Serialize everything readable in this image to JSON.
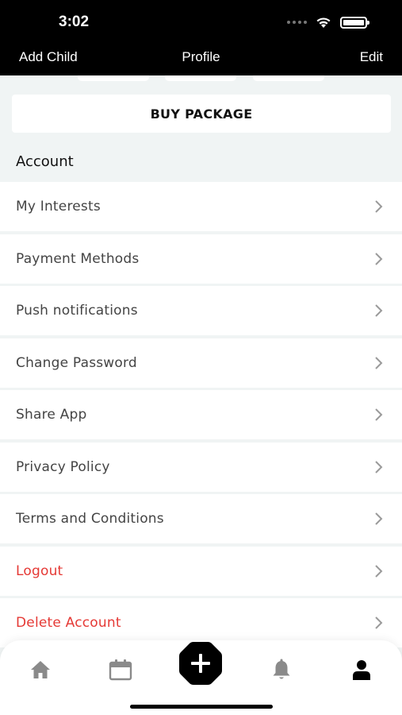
{
  "status_bar": {
    "time": "3:02"
  },
  "nav": {
    "left": "Add Child",
    "title": "Profile",
    "right": "Edit"
  },
  "buy_button": "BUY PACKAGE",
  "section_title": "Account",
  "menu_items": [
    {
      "label": "My Interests",
      "style": "normal"
    },
    {
      "label": "Payment Methods",
      "style": "normal"
    },
    {
      "label": "Push notifications",
      "style": "normal"
    },
    {
      "label": "Change Password",
      "style": "normal"
    },
    {
      "label": "Share App",
      "style": "normal"
    },
    {
      "label": "Privacy Policy",
      "style": "normal"
    },
    {
      "label": "Terms and Conditions",
      "style": "normal"
    },
    {
      "label": "Logout",
      "style": "danger"
    },
    {
      "label": "Delete Account",
      "style": "danger"
    }
  ],
  "tabs": [
    {
      "icon": "home-icon",
      "active": false
    },
    {
      "icon": "calendar-icon",
      "active": false
    },
    {
      "icon": "plus-icon",
      "active": false
    },
    {
      "icon": "bell-icon",
      "active": false
    },
    {
      "icon": "profile-icon",
      "active": true
    }
  ],
  "colors": {
    "header_bg": "#000000",
    "danger": "#e53935",
    "inactive_icon": "#8a8a8a",
    "active_icon": "#000000"
  }
}
